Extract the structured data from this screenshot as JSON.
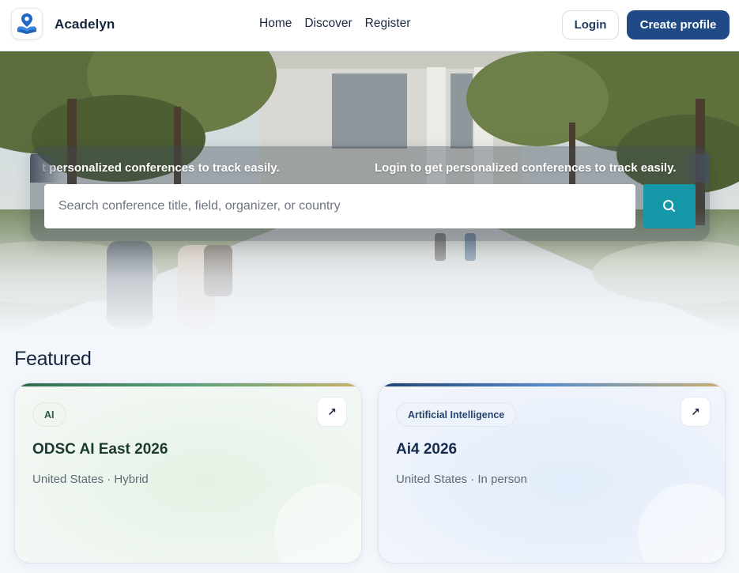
{
  "header": {
    "brand": "Acadelyn",
    "nav": [
      "Home",
      "Discover",
      "Register"
    ],
    "login_label": "Login",
    "create_profile_label": "Create profile"
  },
  "hero": {
    "marquee_text": "Login to get personalized conferences to track easily.",
    "marquee_text_partial": "t personalized conferences to track easily.",
    "search_placeholder": "Search conference title, field, organizer, or country",
    "search_icon": "search-icon"
  },
  "featured": {
    "title": "Featured",
    "cards": [
      {
        "tag": "AI",
        "title": "ODSC AI East 2026",
        "meta": "United States · Hybrid",
        "open_icon": "↗"
      },
      {
        "tag": "Artificial Intelligence",
        "title": "Ai4 2026",
        "meta": "United States · In person",
        "open_icon": "↗"
      }
    ]
  },
  "colors": {
    "primary": "#1f4a86",
    "search_button": "#1597a8",
    "logo_pin": "#1e66c8"
  }
}
